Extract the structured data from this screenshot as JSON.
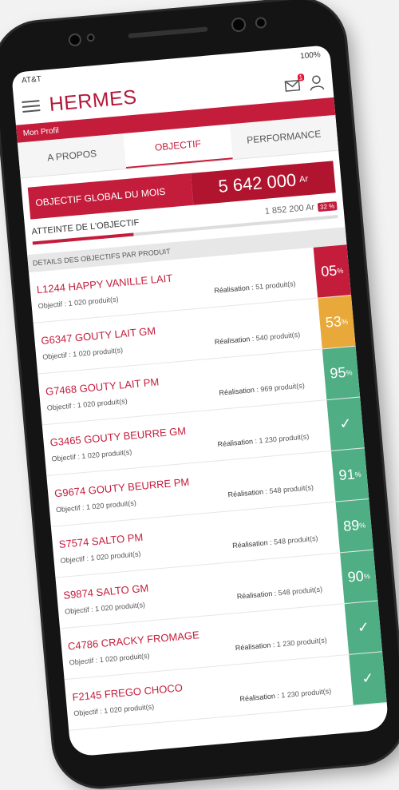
{
  "status": {
    "carrier": "AT&T",
    "battery": "100%"
  },
  "app": {
    "title": "HERMES",
    "profile_label": "Mon Profil",
    "notif_count": "1"
  },
  "tabs": [
    {
      "label": "A PROPOS"
    },
    {
      "label": "OBJECTIF"
    },
    {
      "label": "PERFORMANCE"
    }
  ],
  "objective": {
    "label": "OBJECTIF GLOBAL DU MOIS",
    "value": "5 642 000",
    "unit": "Ar"
  },
  "attainment": {
    "label": "ATTEINTE DE L'OBJECTIF",
    "value": "1 852 200 Ar",
    "percent": "32 %",
    "progress_fraction": 0.33
  },
  "section_title": "DETAILS DES OBJECTIFS PAR PRODUIT",
  "objectif_prefix": "Objectif :",
  "realisation_prefix": "Réalisation :",
  "products": [
    {
      "name": "L1244  HAPPY VANILLE LAIT",
      "objectif": "1 020 produit(s)",
      "realisation": "51 produit(s)",
      "pct": "05",
      "color": "#c41d3c",
      "check": false
    },
    {
      "name": "G6347 GOUTY LAIT GM",
      "objectif": "1 020 produit(s)",
      "realisation": "540 produit(s)",
      "pct": "53",
      "color": "#e9a93a",
      "check": false
    },
    {
      "name": "G7468 GOUTY LAIT PM",
      "objectif": "1 020 produit(s)",
      "realisation": "969 produit(s)",
      "pct": "95",
      "color": "#4fae84",
      "check": false
    },
    {
      "name": "G3465 GOUTY BEURRE GM",
      "objectif": "1 020 produit(s)",
      "realisation": "1 230 produit(s)",
      "pct": "",
      "color": "#4fae84",
      "check": true
    },
    {
      "name": "G9674 GOUTY BEURRE PM",
      "objectif": "1 020 produit(s)",
      "realisation": "548 produit(s)",
      "pct": "91",
      "color": "#4fae84",
      "check": false
    },
    {
      "name": "S7574 SALTO PM",
      "objectif": "1 020 produit(s)",
      "realisation": "548 produit(s)",
      "pct": "89",
      "color": "#4fae84",
      "check": false
    },
    {
      "name": "S9874 SALTO GM",
      "objectif": "1 020 produit(s)",
      "realisation": "548 produit(s)",
      "pct": "90",
      "color": "#4fae84",
      "check": false
    },
    {
      "name": "C4786 CRACKY FROMAGE",
      "objectif": "1 020 produit(s)",
      "realisation": "1 230 produit(s)",
      "pct": "",
      "color": "#4fae84",
      "check": true
    },
    {
      "name": "F2145 FREGO CHOCO",
      "objectif": "1 020 produit(s)",
      "realisation": "1 230 produit(s)",
      "pct": "",
      "color": "#4fae84",
      "check": true
    }
  ],
  "percent_sign": "%",
  "check_glyph": "✓"
}
